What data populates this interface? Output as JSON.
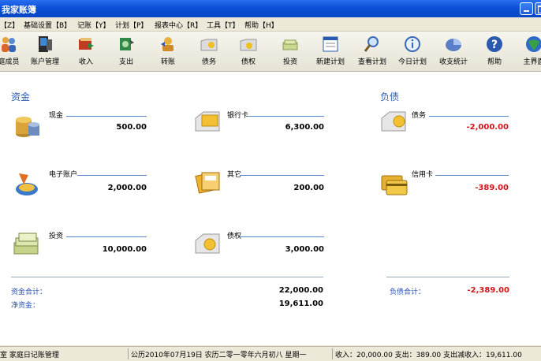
{
  "window": {
    "title": "我家账簿"
  },
  "menu": [
    "【Z】",
    "基础设置【B】",
    "记账【Y】",
    "计划【P】",
    "报表中心【R】",
    "工具【T】",
    "帮助【H】"
  ],
  "toolbar": [
    {
      "label": "庭成员",
      "icon": "family-icon"
    },
    {
      "label": "账户管理",
      "icon": "account-manage-icon"
    },
    {
      "label": "收入",
      "icon": "income-icon"
    },
    {
      "label": "支出",
      "icon": "expense-icon"
    },
    {
      "label": "转账",
      "icon": "transfer-icon"
    },
    {
      "label": "债务",
      "icon": "debt-icon"
    },
    {
      "label": "债权",
      "icon": "claim-icon"
    },
    {
      "label": "投资",
      "icon": "investment-icon"
    },
    {
      "label": "新建计划",
      "icon": "new-plan-icon"
    },
    {
      "label": "查看计划",
      "icon": "view-plan-icon"
    },
    {
      "label": "今日计划",
      "icon": "today-plan-icon"
    },
    {
      "label": "收支统计",
      "icon": "statistics-icon"
    },
    {
      "label": "帮助",
      "icon": "help-icon"
    },
    {
      "label": "主界面",
      "icon": "home-icon"
    }
  ],
  "assets": {
    "title": "资金",
    "accounts": [
      {
        "name": "现金",
        "value": "500.00",
        "icon": "cash-coins-icon"
      },
      {
        "name": "银行卡",
        "value": "6,300.00",
        "icon": "bank-card-icon"
      },
      {
        "name": "电子账户",
        "value": "2,000.00",
        "icon": "e-account-icon"
      },
      {
        "name": "其它",
        "value": "200.00",
        "icon": "other-icon"
      },
      {
        "name": "投资",
        "value": "10,000.00",
        "icon": "investment-money-icon"
      },
      {
        "name": "债权",
        "value": "3,000.00",
        "icon": "claim-folder-icon"
      }
    ],
    "total_label": "资金合计：",
    "total_value": "22,000.00",
    "net_label": "净资金：",
    "net_value": "19,611.00"
  },
  "liabilities": {
    "title": "负债",
    "accounts": [
      {
        "name": "债务",
        "value": "-2,000.00",
        "icon": "debt-folder-icon"
      },
      {
        "name": "信用卡",
        "value": "-389.00",
        "icon": "credit-card-icon"
      }
    ],
    "total_label": "负债合计：",
    "total_value": "-2,389.00"
  },
  "status": {
    "left": "室 家庭日记账管理",
    "date": "公历2010年07月19日  农历二零一零年六月初八   星期一",
    "summary": "收入：20,000.00  支出：389.00  支出减收入：19,611.00"
  },
  "colors": {
    "accent": "#2b5fb4",
    "negative": "#d4141c",
    "titlebar": "#0a4fd6"
  }
}
